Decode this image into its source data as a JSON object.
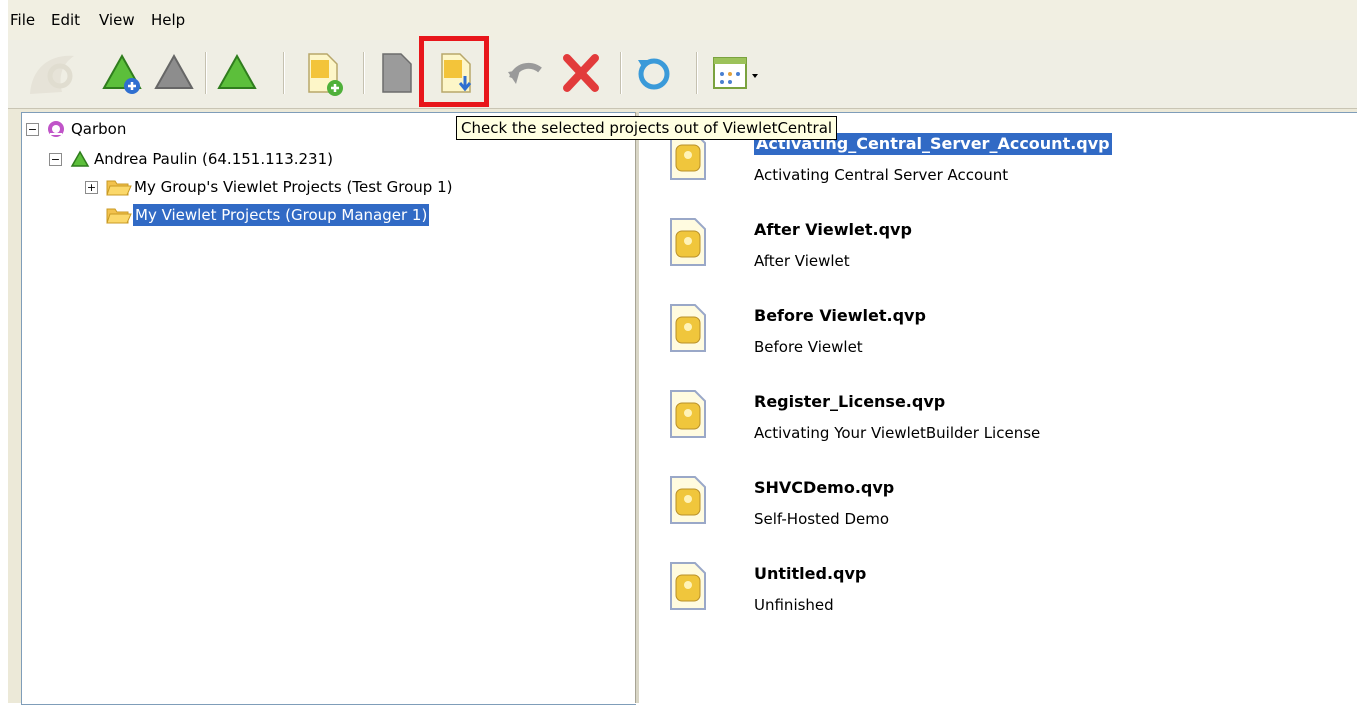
{
  "menu": {
    "file": "File",
    "edit": "Edit",
    "view": "View",
    "help": "Help"
  },
  "toolbar": {
    "tooltip": "Check the selected projects out of ViewletCentral",
    "buttons": [
      "add-account-icon",
      "remove-account-icon",
      "connect-icon",
      "new-project-icon",
      "check-in-icon",
      "check-out-icon",
      "undo-icon",
      "delete-icon",
      "refresh-icon",
      "view-options-icon"
    ]
  },
  "tree": {
    "root": {
      "label": "Qarbon",
      "expander": "−"
    },
    "user": {
      "label": "Andrea Paulin (64.151.113.231)",
      "expander": "−"
    },
    "items": [
      {
        "label": "My Group's Viewlet Projects (Test Group 1)",
        "expander": "+",
        "selected": false
      },
      {
        "label": "My Viewlet Projects (Group Manager 1)",
        "selected": true
      }
    ]
  },
  "files": [
    {
      "name": "Activating_Central_Server_Account.qvp",
      "description": "Activating Central Server Account",
      "selected": true
    },
    {
      "name": "After Viewlet.qvp",
      "description": "After Viewlet",
      "selected": false
    },
    {
      "name": "Before Viewlet.qvp",
      "description": "Before Viewlet",
      "selected": false
    },
    {
      "name": "Register_License.qvp",
      "description": "Activating Your ViewletBuilder License",
      "selected": false
    },
    {
      "name": "SHVCDemo.qvp",
      "description": "Self-Hosted Demo",
      "selected": false
    },
    {
      "name": "Untitled.qvp",
      "description": "Unfinished",
      "selected": false
    }
  ],
  "colors": {
    "highlight": "#e8161b",
    "selection": "#316ac5",
    "tooltip_bg": "#ffffe1"
  }
}
